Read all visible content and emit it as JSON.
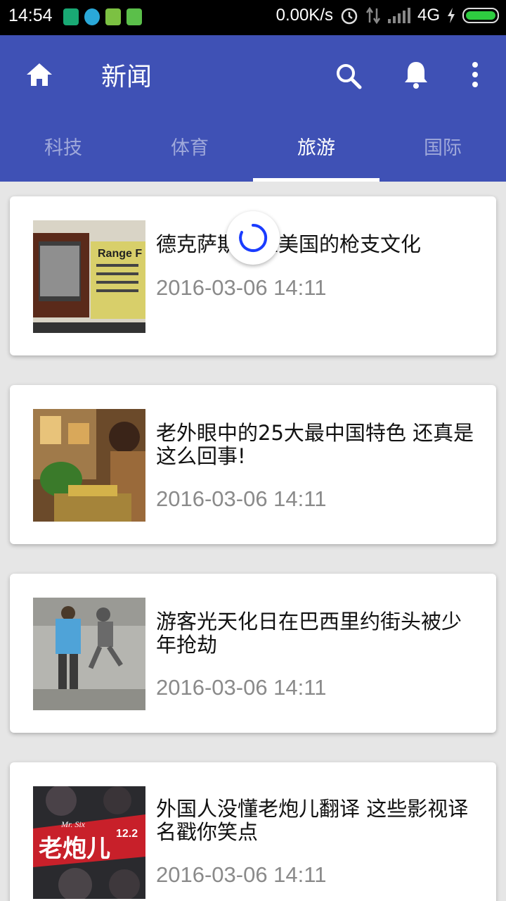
{
  "status_bar": {
    "time": "14:54",
    "net_speed": "0.00K/s",
    "network": "4G"
  },
  "app_bar": {
    "title": "新闻"
  },
  "tabs": [
    {
      "label": "科技"
    },
    {
      "label": "体育"
    },
    {
      "label": "旅游"
    },
    {
      "label": "国际"
    }
  ],
  "active_tab": "旅游",
  "colors": {
    "primary": "#3f51b5",
    "tab_inactive": "#9fa8da",
    "spinner": "#1a3cff"
  },
  "articles": [
    {
      "title": "德克萨斯体验美国的枪支文化",
      "date": "2016-03-06 14:11",
      "image": "range-sign-photo"
    },
    {
      "title": "老外眼中的25大最中国特色 还真是这么回事!",
      "date": "2016-03-06 14:11",
      "image": "shopping-photo"
    },
    {
      "title": "游客光天化日在巴西里约街头被少年抢劫",
      "date": "2016-03-06 14:11",
      "image": "street-robbery-photo"
    },
    {
      "title": "外国人没懂老炮儿翻译 这些影视译名戳你笑点",
      "date": "2016-03-06 14:11",
      "image": "movie-poster-photo"
    }
  ],
  "thumb_text": {
    "range": "Range F",
    "poster": "老炮儿",
    "poster_en": "Mr. Six",
    "poster_num": "12.2"
  }
}
